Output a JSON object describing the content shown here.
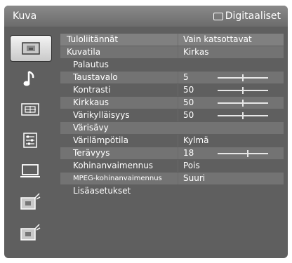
{
  "header": {
    "title": "Kuva",
    "source_label": "Digitaaliset",
    "source_icon": "tv-screen-icon"
  },
  "sidebar": {
    "items": [
      {
        "name": "picture-icon",
        "selected": true
      },
      {
        "name": "music-note-icon",
        "selected": false
      },
      {
        "name": "screen-format-icon",
        "selected": false
      },
      {
        "name": "settings-list-icon",
        "selected": false
      },
      {
        "name": "monitor-icon",
        "selected": false
      },
      {
        "name": "analog-setup-icon",
        "selected": false
      },
      {
        "name": "digital-setup-icon",
        "selected": false
      }
    ]
  },
  "menu": {
    "rows": [
      {
        "label": "Tuloliitännät",
        "value": "Vain katsottavat"
      },
      {
        "label": "Kuvatila",
        "value": "Kirkas"
      },
      {
        "label": "Palautus",
        "value": ""
      },
      {
        "label": "Taustavalo",
        "value": "5",
        "slider": 0.5
      },
      {
        "label": "Kontrasti",
        "value": "50",
        "slider": 0.5
      },
      {
        "label": "Kirkkaus",
        "value": "50",
        "slider": 0.5
      },
      {
        "label": "Värikylläisyys",
        "value": "50",
        "slider": 0.5
      },
      {
        "label": "Värisävy",
        "value": ""
      },
      {
        "label": "Värilämpötila",
        "value": "Kylmä"
      },
      {
        "label": "Terävyys",
        "value": "18",
        "slider": 0.6
      },
      {
        "label": "Kohinanvaimennus",
        "value": "Pois"
      },
      {
        "label": "MPEG-kohinanvaimennus",
        "value": "Suuri"
      },
      {
        "label": "Lisäasetukset",
        "value": ""
      }
    ]
  }
}
